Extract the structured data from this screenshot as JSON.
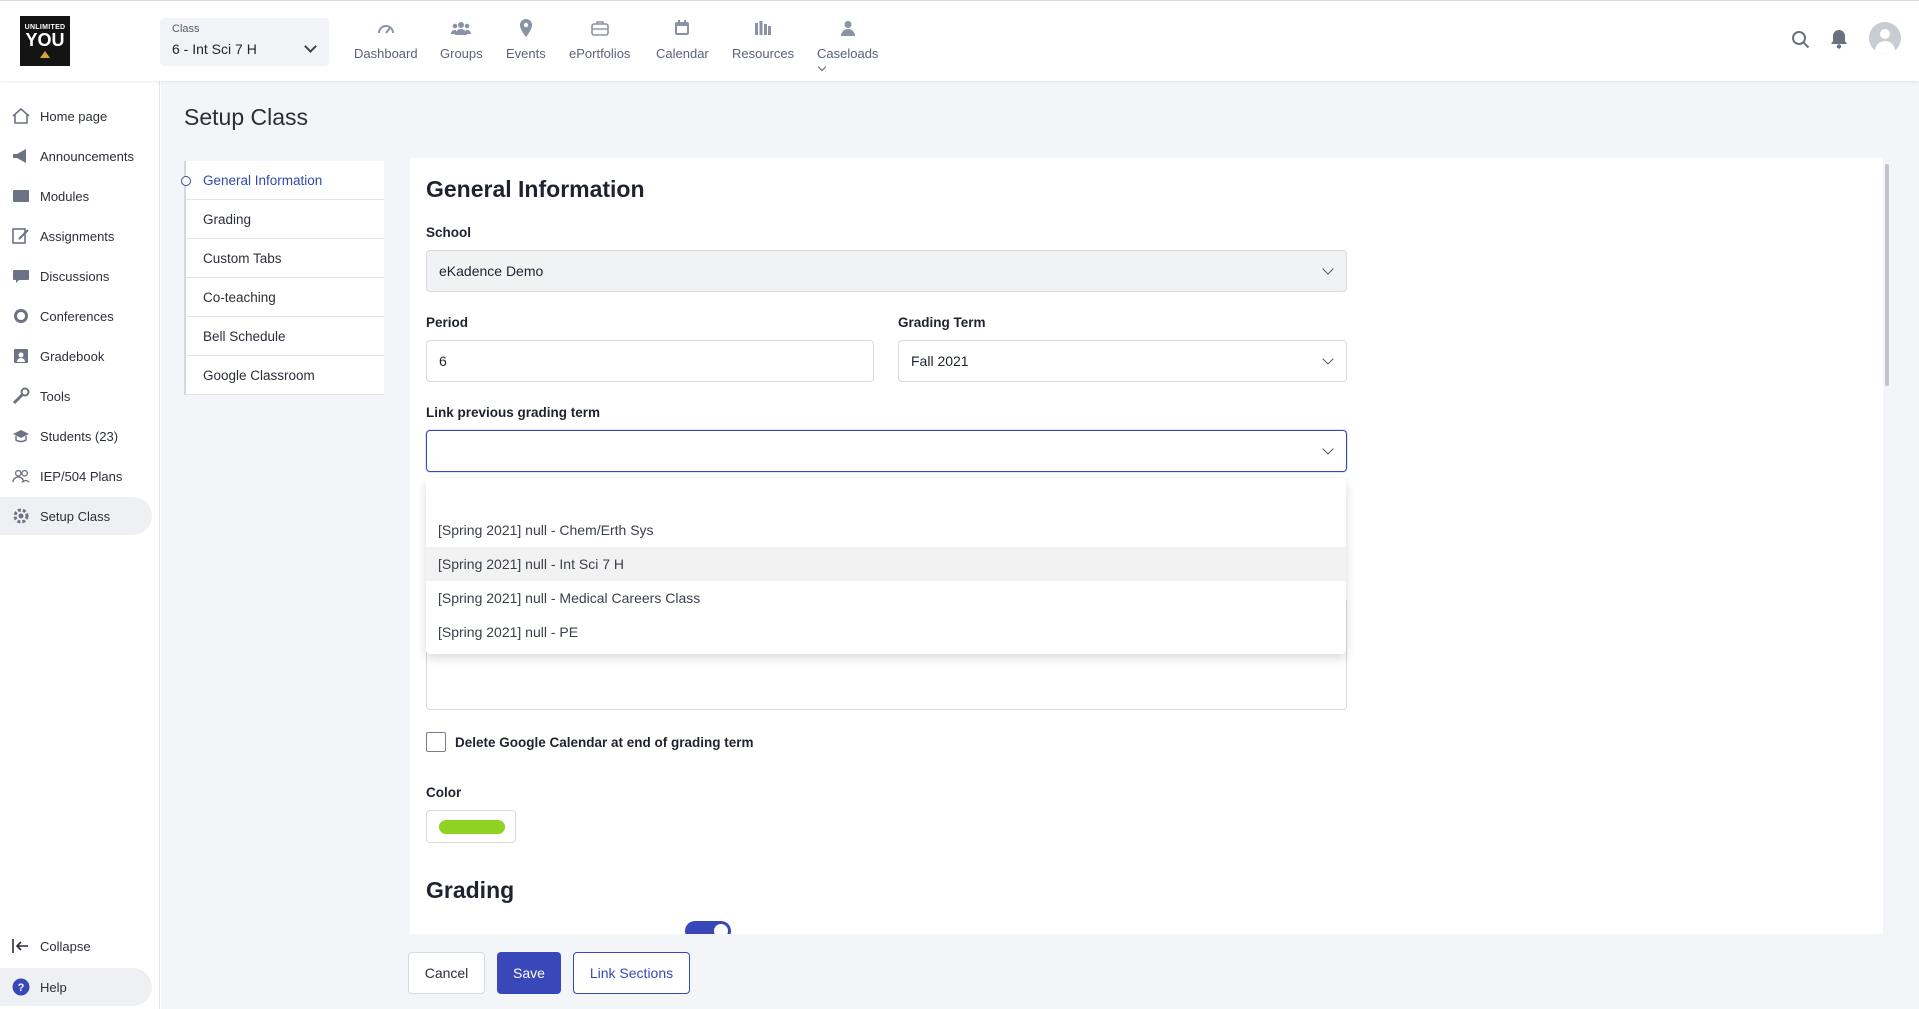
{
  "header": {
    "logo_lines": [
      "UNLIMITED",
      "YOU"
    ],
    "class_selector": {
      "label": "Class",
      "value": "6 - Int Sci 7 H"
    },
    "nav": [
      {
        "label": "Dashboard",
        "icon": "dashboard-icon"
      },
      {
        "label": "Groups",
        "icon": "groups-icon"
      },
      {
        "label": "Events",
        "icon": "events-icon"
      },
      {
        "label": "ePortfolios",
        "icon": "eportfolios-icon"
      },
      {
        "label": "Calendar",
        "icon": "calendar-icon"
      },
      {
        "label": "Resources",
        "icon": "resources-icon"
      },
      {
        "label": "Caseloads",
        "icon": "caseloads-icon"
      }
    ]
  },
  "sidebar": {
    "items": [
      {
        "label": "Home page",
        "icon": "home-icon"
      },
      {
        "label": "Announcements",
        "icon": "megaphone-icon"
      },
      {
        "label": "Modules",
        "icon": "folder-icon"
      },
      {
        "label": "Assignments",
        "icon": "assignment-icon"
      },
      {
        "label": "Discussions",
        "icon": "discussion-icon"
      },
      {
        "label": "Conferences",
        "icon": "chat-icon"
      },
      {
        "label": "Gradebook",
        "icon": "gradebook-icon"
      },
      {
        "label": "Tools",
        "icon": "tools-icon"
      },
      {
        "label": "Students (23)",
        "icon": "students-icon"
      },
      {
        "label": "IEP/504 Plans",
        "icon": "people-icon"
      },
      {
        "label": "Setup Class",
        "icon": "gear-icon"
      }
    ],
    "collapse_label": "Collapse",
    "help_label": "Help"
  },
  "page": {
    "title": "Setup Class",
    "subnav": [
      "General Information",
      "Grading",
      "Custom Tabs",
      "Co-teaching",
      "Bell Schedule",
      "Google Classroom"
    ]
  },
  "form": {
    "section_title": "General Information",
    "school_label": "School",
    "school_value": "eKadence Demo",
    "period_label": "Period",
    "period_value": "6",
    "grading_term_label": "Grading Term",
    "grading_term_value": "Fall 2021",
    "link_prev_label": "Link previous grading term",
    "link_prev_value": "",
    "link_prev_options": [
      "[Spring 2021] null - Chem/Erth Sys",
      "[Spring 2021] null - Int Sci 7 H",
      "[Spring 2021] null - Medical Careers Class",
      "[Spring 2021] null - PE"
    ],
    "delete_calendar_label": "Delete Google Calendar at end of grading term",
    "color_label": "Color",
    "color_value": "#8ed321",
    "grading_title": "Grading"
  },
  "footer": {
    "cancel_label": "Cancel",
    "save_label": "Save",
    "link_sections_label": "Link Sections"
  },
  "colors": {
    "accent": "#3848b8"
  }
}
